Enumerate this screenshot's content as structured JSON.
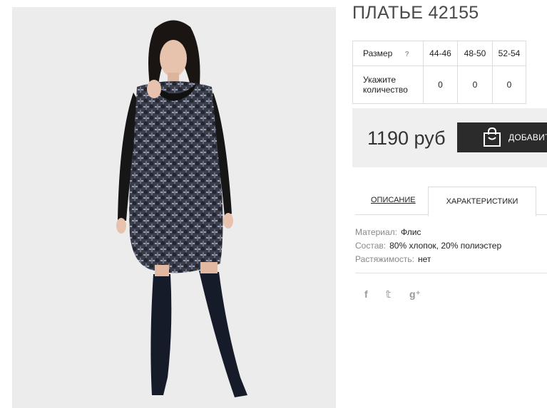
{
  "product": {
    "title": "ПЛАТЬЕ 42155",
    "image_alt": "Model wearing patterned tunic dress with black sleeves and suede over-the-knee boots"
  },
  "size_table": {
    "size_label": "Размер",
    "help_icon": "?",
    "sizes": [
      "44-46",
      "48-50",
      "52-54"
    ],
    "qty_label": "Укажите количество",
    "quantities": [
      "0",
      "0",
      "0"
    ]
  },
  "price": {
    "amount": "1190 руб",
    "add_button": "ДОБАВИТЬ"
  },
  "tabs": {
    "description": "ОПИСАНИЕ",
    "characteristics": "ХАРАКТЕРИСТИКИ"
  },
  "specs": [
    {
      "key": "Материал:",
      "value": "Флис"
    },
    {
      "key": "Состав:",
      "value": "80% хлопок, 20% полиэстер"
    },
    {
      "key": "Растяжимость:",
      "value": "нет"
    }
  ],
  "social": {
    "facebook": "f",
    "twitter": "𝕥",
    "google": "g⁺"
  },
  "colors": {
    "button_bg": "#2b2b2b",
    "price_box_bg": "#efefef",
    "photo_bg": "#ececec"
  }
}
